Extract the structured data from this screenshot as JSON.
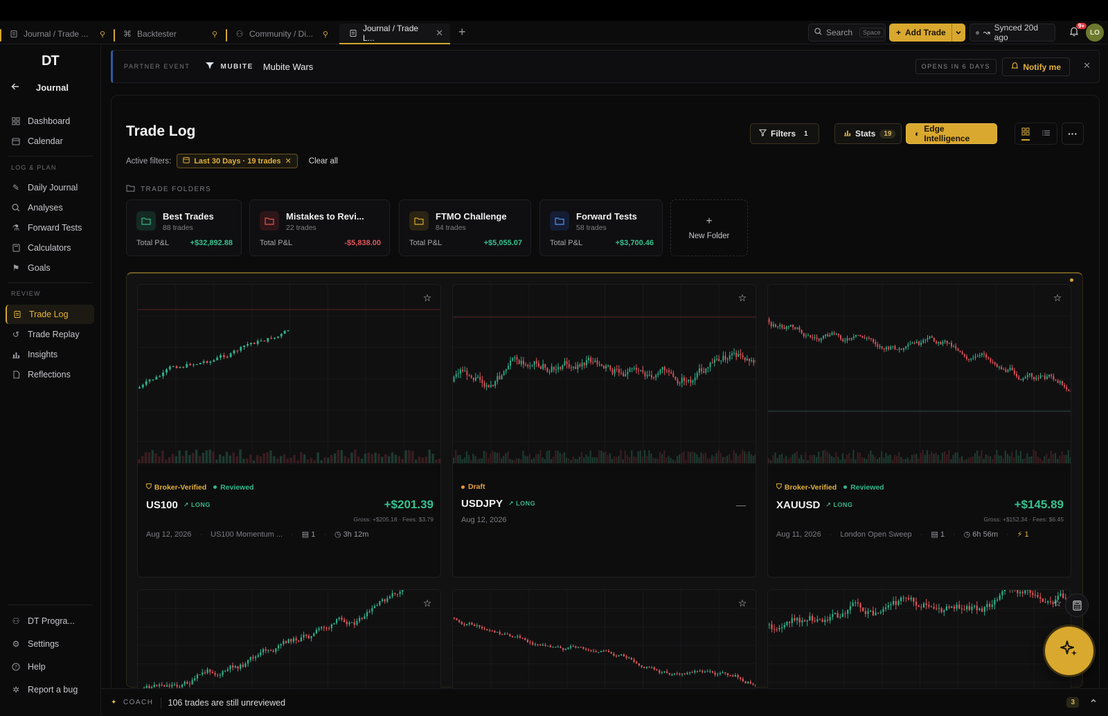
{
  "tabs": [
    {
      "label": "Journal / Trade ...",
      "pinned": true,
      "active": false
    },
    {
      "label": "Backtester",
      "pinned": true,
      "active": false
    },
    {
      "label": "Community / Di...",
      "pinned": true,
      "active": false
    },
    {
      "label": "Journal / Trade L...",
      "pinned": false,
      "active": true
    }
  ],
  "topbar": {
    "search_label": "Search",
    "search_kbd": "Space",
    "add_trade_label": "Add Trade",
    "synced_label": "Synced 20d ago",
    "notif_badge": "9+",
    "avatar_initials": "LO"
  },
  "sidebar": {
    "logo": "DT",
    "back_label": "Journal",
    "top_items": [
      {
        "label": "Dashboard",
        "icon": "grid-icon"
      },
      {
        "label": "Calendar",
        "icon": "calendar-icon"
      }
    ],
    "section_log": "LOG & PLAN",
    "log_items": [
      {
        "label": "Daily Journal",
        "icon": "pen-icon"
      },
      {
        "label": "Analyses",
        "icon": "search-icon"
      },
      {
        "label": "Forward Tests",
        "icon": "flask-icon"
      },
      {
        "label": "Calculators",
        "icon": "calculator-icon"
      },
      {
        "label": "Goals",
        "icon": "flag-icon"
      }
    ],
    "section_review": "REVIEW",
    "review_items": [
      {
        "label": "Trade Log",
        "icon": "log-icon",
        "active": true
      },
      {
        "label": "Trade Replay",
        "icon": "replay-icon"
      },
      {
        "label": "Insights",
        "icon": "bar-chart-icon"
      },
      {
        "label": "Reflections",
        "icon": "document-icon"
      }
    ],
    "bottom_items": [
      {
        "label": "DT Progra...",
        "icon": "users-icon"
      },
      {
        "label": "Settings",
        "icon": "gear-icon"
      },
      {
        "label": "Help",
        "icon": "help-icon"
      },
      {
        "label": "Report a bug",
        "icon": "bug-icon"
      }
    ]
  },
  "banner": {
    "label": "PARTNER EVENT",
    "brand": "MUBITE",
    "event": "Mubite Wars",
    "opens": "OPENS IN 6 DAYS",
    "notify": "Notify me"
  },
  "page": {
    "title": "Trade Log",
    "filters_label": "Filters",
    "filters_count": "1",
    "stats_label": "Stats",
    "stats_count": "19",
    "edge_label": "Edge Intelligence",
    "active_filters_label": "Active filters:",
    "active_filter_chip": "Last 30 Days · 19 trades",
    "clear_all": "Clear all",
    "folders_header": "TRADE FOLDERS"
  },
  "folders": [
    {
      "name": "Best Trades",
      "count": "88 trades",
      "pl_label": "Total P&L",
      "pl": "+$32,892.88",
      "color": "#35b58a",
      "positive": true
    },
    {
      "name": "Mistakes to Revi...",
      "count": "22 trades",
      "pl_label": "Total P&L",
      "pl": "-$5,838.00",
      "color": "#e0555a",
      "positive": false
    },
    {
      "name": "FTMO Challenge",
      "count": "84 trades",
      "pl_label": "Total P&L",
      "pl": "+$5,055.07",
      "color": "#d4a72c",
      "positive": true
    },
    {
      "name": "Forward Tests",
      "count": "58 trades",
      "pl_label": "Total P&L",
      "pl": "+$3,700.46",
      "color": "#4a7fd6",
      "positive": true
    }
  ],
  "new_folder_label": "New Folder",
  "trades": [
    {
      "verified": "Broker-Verified",
      "status": "Reviewed",
      "symbol": "US100",
      "direction": "LONG",
      "pnl": "+$201.39",
      "gross": "Gross: +$205.18 · Fees: $3.79",
      "date": "Aug 12, 2026",
      "strategy": "US100 Momentum ...",
      "notes": "1",
      "duration": "3h 12m",
      "bolts": ""
    },
    {
      "verified": "",
      "status": "Draft",
      "symbol": "USDJPY",
      "direction": "LONG",
      "pnl": "",
      "gross": "",
      "date": "Aug 12, 2026",
      "strategy": "",
      "notes": "",
      "duration": "",
      "bolts": ""
    },
    {
      "verified": "Broker-Verified",
      "status": "Reviewed",
      "symbol": "XAUUSD",
      "direction": "LONG",
      "pnl": "+$145.89",
      "gross": "Gross: +$152.34 · Fees: $6.45",
      "date": "Aug 11, 2026",
      "strategy": "London Open Sweep",
      "notes": "1",
      "duration": "6h 56m",
      "bolts": "1"
    }
  ],
  "coach": {
    "label": "COACH",
    "message": "106 trades are still unreviewed",
    "count": "3"
  },
  "colors": {
    "accent": "#d9a82e",
    "positive": "#35b58a",
    "negative": "#e0555a",
    "up_candle": "#2fb08a",
    "down_candle": "#e0555a"
  }
}
